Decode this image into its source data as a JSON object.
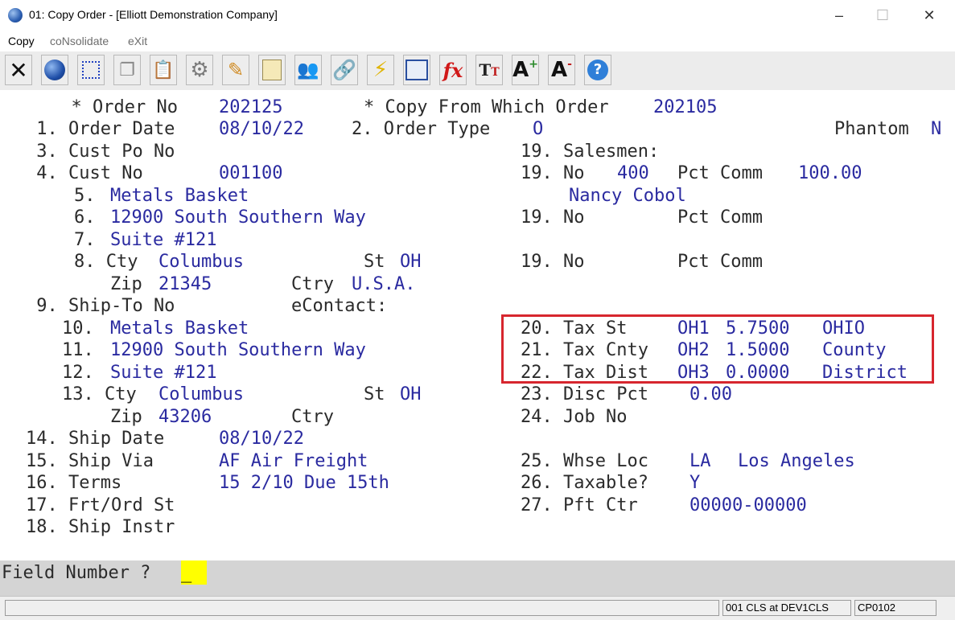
{
  "window": {
    "title": "01: Copy Order - [Elliott Demonstration Company]",
    "controls": [
      "–",
      "☐",
      "✕"
    ]
  },
  "menu": [
    {
      "label": "Copy"
    },
    {
      "label": "coNsolidate"
    },
    {
      "label": "eXit"
    }
  ],
  "toolbar": {
    "icons": [
      "close-icon",
      "globe-icon",
      "select-icon",
      "copy-icon",
      "paste-icon",
      "settings-icon",
      "edit-icon",
      "notes-icon",
      "users-icon",
      "links-icon",
      "lightning-icon",
      "screen-icon",
      "fx-icon",
      "text-size-icon",
      "font-increase-icon",
      "font-decrease-icon",
      "help-icon"
    ]
  },
  "form": {
    "order_no": {
      "label": "  * Order No",
      "value": "202125"
    },
    "copy_from": {
      "label": "* Copy From Which Order",
      "value": "202105"
    },
    "order_date": {
      "label": " 1. Order Date",
      "value": "08/10/22"
    },
    "order_type": {
      "label": "2. Order Type",
      "value": "O"
    },
    "phantom": {
      "label": "Phantom",
      "value": "N"
    },
    "cust_po": {
      "label": " 3. Cust Po No"
    },
    "salesmen": {
      "label": "19. Salesmen:"
    },
    "cust_no": {
      "label": " 4. Cust No",
      "value": "001100"
    },
    "sales1": {
      "no_label": "19. No",
      "no": "400",
      "pct_label": "Pct Comm",
      "pct": "100.00",
      "name": "Nancy Cobol"
    },
    "sales2": {
      "no_label": "19. No",
      "pct_label": "Pct Comm"
    },
    "sales3": {
      "no_label": "19. No",
      "pct_label": "Pct Comm"
    },
    "bill_name": {
      "label": "5.",
      "value": "Metals Basket"
    },
    "bill_addr1": {
      "label": "6.",
      "value": "12900 South Southern Way"
    },
    "bill_addr2": {
      "label": "7.",
      "value": "Suite #121"
    },
    "bill_city": {
      "label": "8. Cty",
      "value": "Columbus",
      "st_label": "St",
      "st": "OH"
    },
    "bill_zip": {
      "label": "Zip",
      "value": "21345",
      "ctry_label": "Ctry",
      "ctry": "U.S.A."
    },
    "ship_to_no": {
      "label": " 9. Ship-To No",
      "econtact": "eContact:"
    },
    "ship_name": {
      "label": "10.",
      "value": "Metals Basket"
    },
    "ship_addr1": {
      "label": "11.",
      "value": "12900 South Southern Way"
    },
    "ship_addr2": {
      "label": "12.",
      "value": "Suite #121"
    },
    "ship_city": {
      "label": "13. Cty",
      "value": "Columbus",
      "st_label": "St",
      "st": "OH"
    },
    "ship_zip": {
      "label": "Zip",
      "value": "43206",
      "ctry_label": "Ctry"
    },
    "tax_st": {
      "label": "20. Tax St",
      "code": "OH1",
      "rate": "5.7500",
      "desc": "OHIO"
    },
    "tax_cnty": {
      "label": "21. Tax Cnty",
      "code": "OH2",
      "rate": "1.5000",
      "desc": "County"
    },
    "tax_dist": {
      "label": "22. Tax Dist",
      "code": "OH3",
      "rate": "0.0000",
      "desc": "District"
    },
    "disc_pct": {
      "label": "23. Disc Pct",
      "value": "0.00"
    },
    "job_no": {
      "label": "24. Job No"
    },
    "ship_date": {
      "label": "14. Ship Date",
      "value": "08/10/22"
    },
    "ship_via": {
      "label": "15. Ship Via",
      "value": "AF Air Freight"
    },
    "whse_loc": {
      "label": "25. Whse Loc",
      "code": "LA",
      "name": "Los Angeles"
    },
    "terms": {
      "label": "16. Terms",
      "value": "15 2/10 Due 15th"
    },
    "taxable": {
      "label": "26. Taxable?",
      "value": "Y"
    },
    "frt_ord": {
      "label": "17. Frt/Ord St"
    },
    "pft_ctr": {
      "label": "27. Pft Ctr",
      "value": "00000-00000"
    },
    "ship_instr": {
      "label": "18. Ship Instr"
    }
  },
  "prompt": {
    "label": "Field Number ?",
    "cursor": "_"
  },
  "status": {
    "panel1": "",
    "panel2": "001 CLS at DEV1CLS",
    "panel3": "CP0102"
  }
}
